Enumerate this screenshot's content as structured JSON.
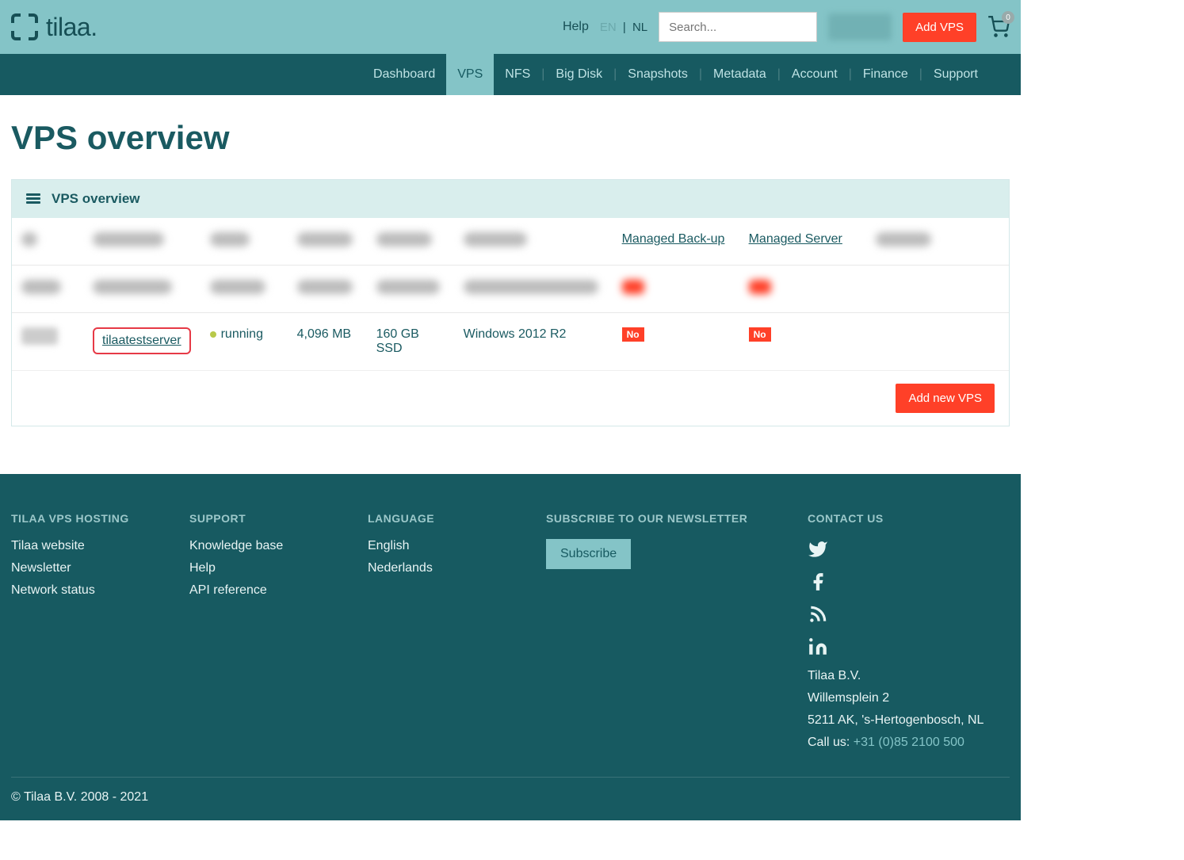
{
  "brand": "tilaa.",
  "top": {
    "help": "Help",
    "lang_en": "EN",
    "lang_nl": "NL",
    "search_placeholder": "Search...",
    "add_vps": "Add VPS",
    "cart_count": "0"
  },
  "nav": {
    "dashboard": "Dashboard",
    "vps": "VPS",
    "nfs": "NFS",
    "bigdisk": "Big Disk",
    "snapshots": "Snapshots",
    "metadata": "Metadata",
    "account": "Account",
    "finance": "Finance",
    "support": "Support"
  },
  "page": {
    "title": "VPS overview",
    "panel_title": "VPS overview",
    "add_new": "Add new VPS"
  },
  "cols": {
    "managed_backup": "Managed Back-up",
    "managed_server": "Managed Server"
  },
  "row": {
    "name": "tilaatestserver",
    "status": "running",
    "memory": "4,096 MB",
    "storage": "160 GB SSD",
    "os": "Windows 2012 R2",
    "backup": "No",
    "managed": "No"
  },
  "footer": {
    "h1": "TILAA VPS HOSTING",
    "h2": "SUPPORT",
    "h3": "LANGUAGE",
    "h4": "SUBSCRIBE TO OUR NEWSLETTER",
    "h5": "CONTACT US",
    "l_website": "Tilaa website",
    "l_newsletter": "Newsletter",
    "l_network": "Network status",
    "l_kb": "Knowledge base",
    "l_help": "Help",
    "l_api": "API reference",
    "l_en": "English",
    "l_nl": "Nederlands",
    "subscribe": "Subscribe",
    "company": "Tilaa B.V.",
    "addr1": "Willemsplein 2",
    "addr2": "5211 AK, 's-Hertogenbosch, NL",
    "call_label": "Call us: ",
    "phone": "+31 (0)85 2100 500",
    "copyright": "© Tilaa B.V. 2008 - 2021"
  }
}
